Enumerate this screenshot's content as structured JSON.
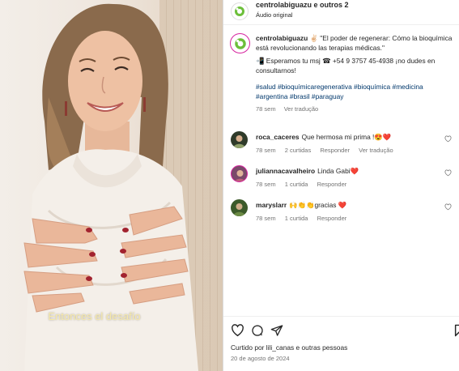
{
  "video": {
    "subtitle": "Entonces el desafío"
  },
  "header": {
    "title": "centrolabiguazu e outros 2",
    "audio": "Áudio original"
  },
  "caption": {
    "username": "centrolabiguazu",
    "line1": "✌🏻 \"El poder de regenerar: Cómo la bioquímica está revolucionando las terapias médicas.\"",
    "line2": "📲 Esperamos tu msj ☎ +54 9 3757 45-4938 ¡no dudes en consultarnos!",
    "hashtags": "#salud #bioquímicaregenerativa #bioquímica #medicina #argentina #brasil #paraguay",
    "time": "78 sem",
    "translate": "Ver tradução"
  },
  "comments": [
    {
      "username": "roca_caceres",
      "text": "Que hermosa mi prima !😍❤️",
      "time": "78 sem",
      "likes": "2 curtidas",
      "reply": "Responder",
      "translate": "Ver tradução",
      "avatar_color": "#2f3b2a"
    },
    {
      "username": "juliannacavalheiro",
      "text": "Linda Gabi❤️",
      "time": "78 sem",
      "likes": "1 curtida",
      "reply": "Responder",
      "translate": "",
      "avatar_color": "#7a4a6a"
    },
    {
      "username": "maryslarr",
      "text": "🙌👏👏gracias ❤️",
      "time": "78 sem",
      "likes": "1 curtida",
      "reply": "Responder",
      "translate": "",
      "avatar_color": "#3c5a2a"
    }
  ],
  "footer": {
    "liked_by": "Curtido por lili_canas e outras pessoas",
    "date": "20 de agosto de 2024"
  },
  "colors": {
    "link": "#00376b",
    "secondary": "#737373",
    "brand_green": "#6cbf3a"
  },
  "icons": [
    "heart-icon",
    "comment-icon",
    "share-icon",
    "bookmark-icon"
  ]
}
